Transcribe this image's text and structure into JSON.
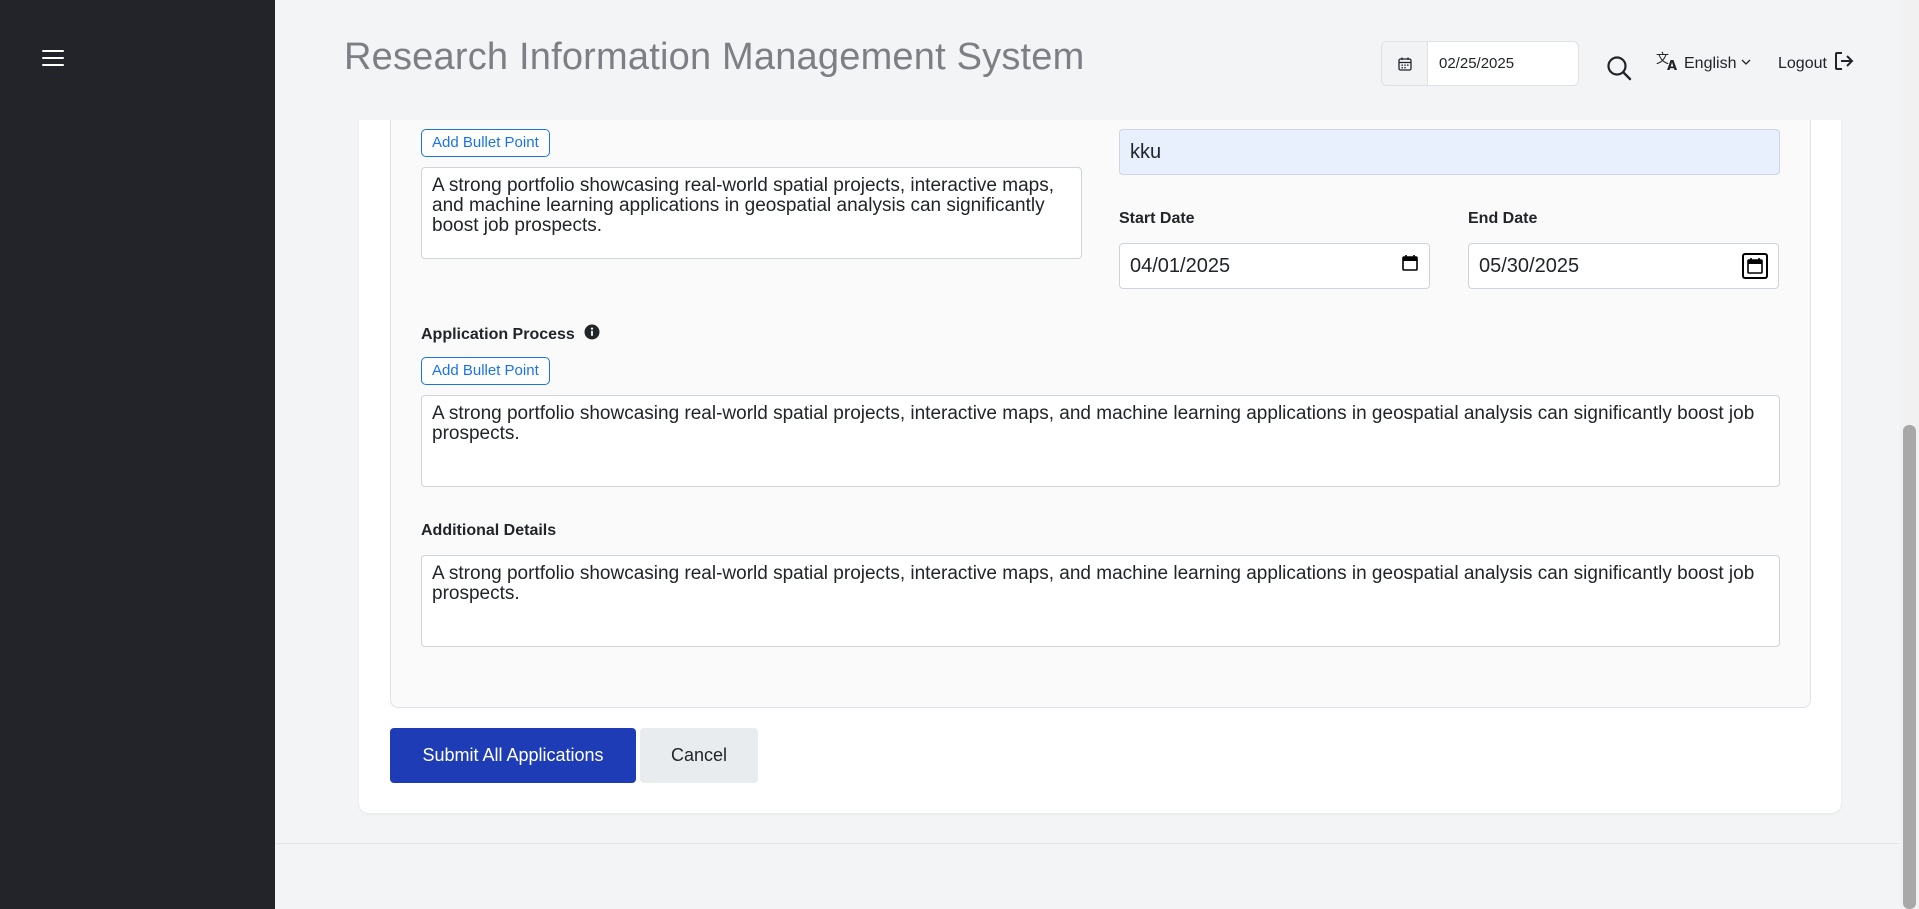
{
  "header": {
    "title": "Research Information Management System",
    "date": "02/25/2025",
    "language": "English",
    "logout": "Logout"
  },
  "form": {
    "top_field_value": "kku",
    "first_section": {
      "add_bullet_label": "Add Bullet Point",
      "text": "A strong portfolio showcasing real-world spatial projects, interactive maps, and machine learning applications in geospatial analysis can significantly boost job prospects."
    },
    "start_date": {
      "label": "Start Date",
      "value": "04/01/2025"
    },
    "end_date": {
      "label": "End Date",
      "value": "05/30/2025"
    },
    "application_process": {
      "label": "Application Process",
      "add_bullet_label": "Add Bullet Point",
      "text": "A strong portfolio showcasing real-world spatial projects, interactive maps, and machine learning applications in geospatial analysis can significantly boost job prospects."
    },
    "additional_details": {
      "label": "Additional Details",
      "text": "A strong portfolio showcasing real-world spatial projects, interactive maps, and machine learning applications in geospatial analysis can significantly boost job prospects."
    }
  },
  "actions": {
    "submit_label": "Submit All Applications",
    "cancel_label": "Cancel"
  },
  "icons": {
    "menu": "hamburger-menu-icon",
    "calendar": "calendar-icon",
    "search": "search-icon",
    "translate": "translate-icon",
    "chevron": "chevron-down-icon",
    "logout": "logout-icon",
    "info": "info-icon"
  },
  "colors": {
    "sidebar": "#232429",
    "primary_button": "#1e3cb5",
    "link_blue": "#1a73e8",
    "filled_input": "#e8f0fe"
  }
}
